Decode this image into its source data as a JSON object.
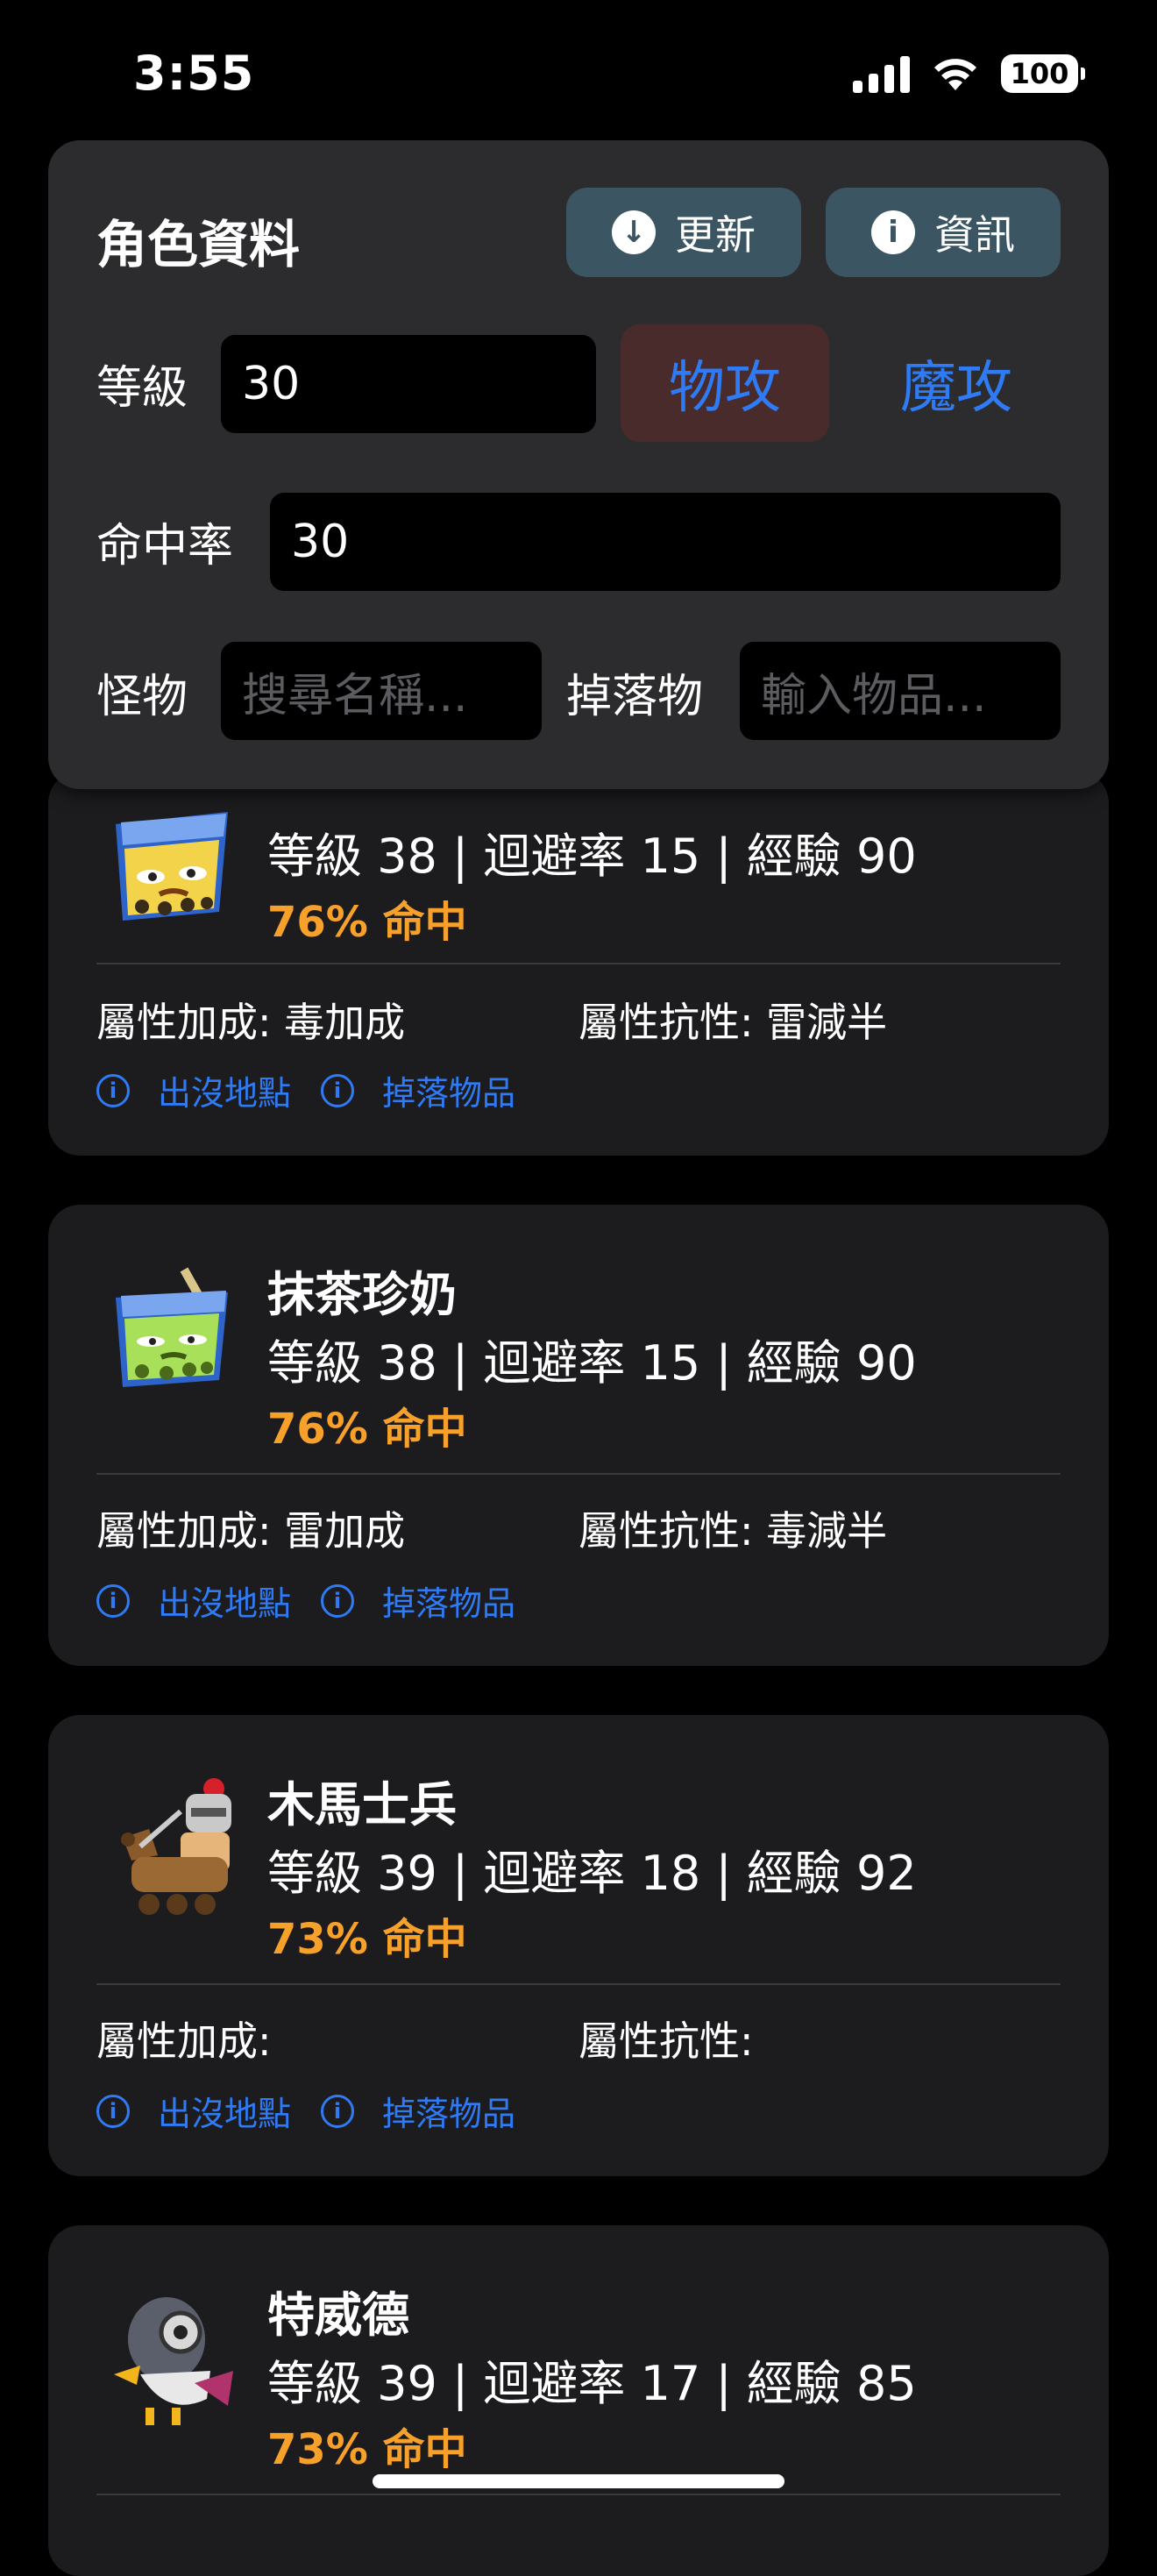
{
  "status_bar": {
    "time": "3:55",
    "battery": "100"
  },
  "panel": {
    "title": "角色資料",
    "update_label": "更新",
    "info_label": "資訊",
    "level_label": "等級",
    "level_value": "30",
    "physical_attack_label": "物攻",
    "magic_attack_label": "魔攻",
    "accuracy_label": "命中率",
    "accuracy_value": "30",
    "monster_label": "怪物",
    "monster_placeholder": "搜尋名稱...",
    "drop_label": "掉落物",
    "drop_placeholder": "輸入物品..."
  },
  "links": {
    "spawn": "出沒地點",
    "drops": "掉落物品"
  },
  "monsters": [
    {
      "name": "",
      "stats": "等級 38 | 迴避率 15 | 經驗 90",
      "hit": "76% 命中",
      "bonus": "屬性加成: 毒加成",
      "resist": "屬性抗性: 雷減半",
      "avatar": "milk-tea-icon"
    },
    {
      "name": "抹茶珍奶",
      "stats": "等級 38 | 迴避率 15 | 經驗 90",
      "hit": "76% 命中",
      "bonus": "屬性加成: 雷加成",
      "resist": "屬性抗性: 毒減半",
      "avatar": "matcha-milk-tea-icon"
    },
    {
      "name": "木馬士兵",
      "stats": "等級 39 | 迴避率 18 | 經驗 92",
      "hit": "73% 命中",
      "bonus": "屬性加成:",
      "resist": "屬性抗性:",
      "avatar": "wooden-horse-soldier-icon"
    },
    {
      "name": "特威德",
      "stats": "等級 39 | 迴避率 17 | 經驗 85",
      "hit": "73% 命中",
      "avatar": "tweed-icon"
    }
  ],
  "colors": {
    "accent": "#2f7bf6",
    "hit": "#f7a12b",
    "card": "#1c1c1e",
    "panel": "#2c2c2e"
  }
}
